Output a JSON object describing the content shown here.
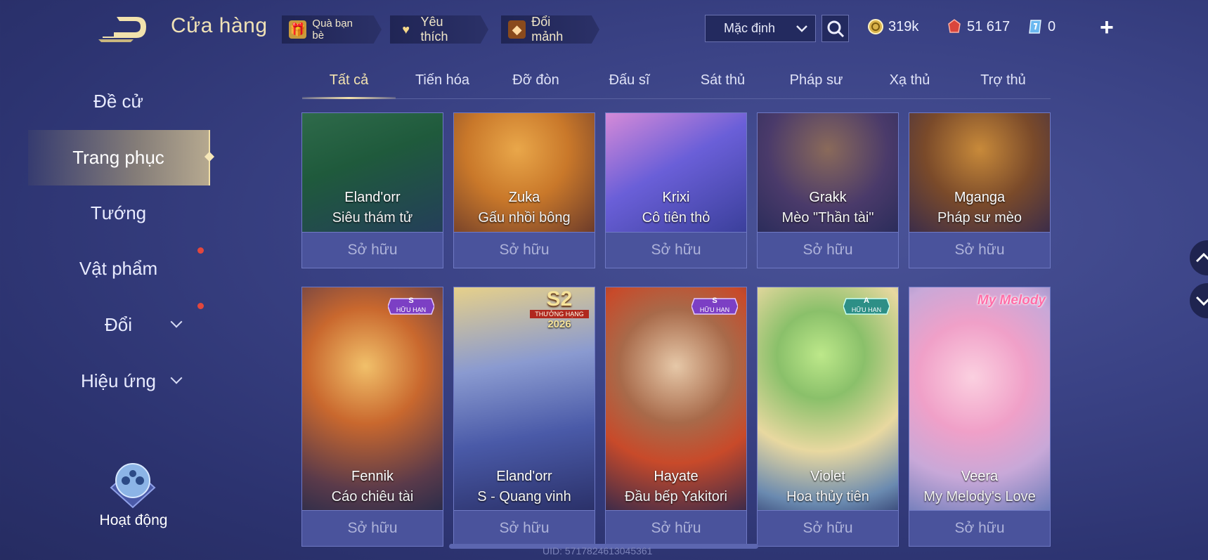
{
  "header": {
    "title": "Cửa hàng",
    "pills": [
      {
        "label": "Quà bạn bè",
        "icon": "gift-icon"
      },
      {
        "label": "Yêu thích",
        "icon": "heart-icon"
      },
      {
        "label": "Đổi mảnh",
        "icon": "fragment-icon"
      }
    ],
    "sort_value": "Mặc định",
    "currencies": [
      {
        "value": "319k",
        "icon": "gold-coin-icon"
      },
      {
        "value": "51 617",
        "icon": "ruby-icon"
      },
      {
        "value": "0",
        "icon": "voucher-icon"
      }
    ]
  },
  "sidebar": {
    "items": [
      {
        "label": "Đề cử"
      },
      {
        "label": "Trang phục"
      },
      {
        "label": "Tướng"
      },
      {
        "label": "Vật phẩm"
      },
      {
        "label": "Đổi"
      },
      {
        "label": "Hiệu ứng"
      }
    ],
    "active_index": 1,
    "activity_label": "Hoạt động"
  },
  "tabs": [
    "Tất cả",
    "Tiến hóa",
    "Đỡ đòn",
    "Đấu sĩ",
    "Sát thủ",
    "Pháp sư",
    "Xạ thủ",
    "Trợ thủ"
  ],
  "active_tab": 0,
  "cards": [
    {
      "hero": "Eland'orr",
      "skin": "Siêu thám tử",
      "button": "Sở hữu"
    },
    {
      "hero": "Zuka",
      "skin": "Gấu nhồi bông",
      "button": "Sở hữu"
    },
    {
      "hero": "Krixi",
      "skin": "Cô tiên thỏ",
      "button": "Sở hữu"
    },
    {
      "hero": "Grakk",
      "skin": "Mèo \"Thần tài\"",
      "button": "Sở hữu"
    },
    {
      "hero": "Mganga",
      "skin": "Pháp sư mèo",
      "button": "Sở hữu"
    },
    {
      "hero": "Fennik",
      "skin": "Cáo chiêu tài",
      "button": "Sở hữu",
      "badge": {
        "tier": "S",
        "text": "HỮU HẠN"
      }
    },
    {
      "hero": "Eland'orr",
      "skin": "S - Quang vinh",
      "button": "Sở hữu",
      "season": {
        "code": "S2",
        "text": "THƯỞNG HẠNG",
        "year": "2026"
      }
    },
    {
      "hero": "Hayate",
      "skin": "Đầu bếp Yakitori",
      "button": "Sở hữu",
      "badge": {
        "tier": "S",
        "text": "HỮU HẠN"
      }
    },
    {
      "hero": "Violet",
      "skin": "Hoa thủy tiên",
      "button": "Sở hữu",
      "badge": {
        "tier": "A",
        "text": "HỮU HẠN"
      }
    },
    {
      "hero": "Veera",
      "skin": "My Melody's Love",
      "button": "Sở hữu",
      "logo": "My Melody"
    }
  ],
  "footer": {
    "uid": "UID: 5717824613045361"
  },
  "colors": {
    "accent": "#f3e1ab",
    "card_button": "#4a539c",
    "background": "#343b7c",
    "badge_s": "#7c3fc4",
    "badge_a": "#2d8f86"
  }
}
